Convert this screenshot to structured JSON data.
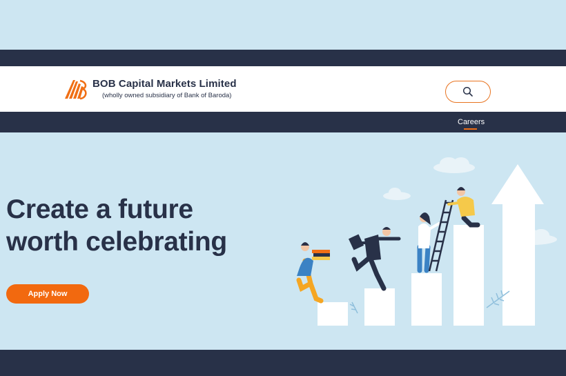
{
  "brand": {
    "title": "BOB Capital Markets Limited",
    "subtitle": "(wholly owned subsidiary of Bank of Baroda)",
    "logo_icon": "bob-sunrays-logo",
    "accent": "#f06f15"
  },
  "header": {
    "search_icon": "search-icon"
  },
  "nav": {
    "items": [
      {
        "label": "Careers",
        "active": true
      }
    ]
  },
  "hero": {
    "headline_line1": "Create a future",
    "headline_line2": "worth celebrating",
    "cta_label": "Apply Now",
    "illustration": "people-climbing-steps-growth"
  },
  "colors": {
    "navy": "#283148",
    "sky": "#cde6f2",
    "orange": "#f2690f"
  }
}
